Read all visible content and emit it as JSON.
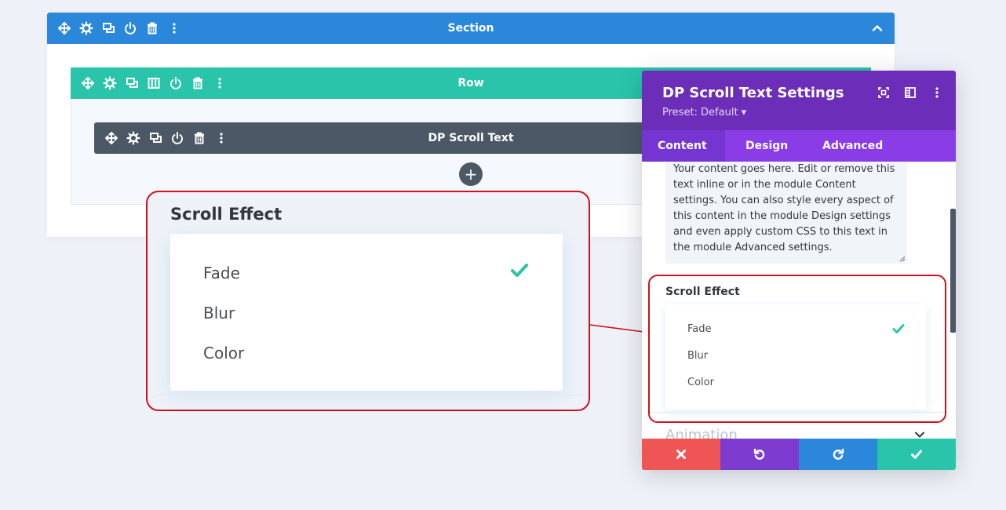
{
  "builder": {
    "section_title": "Section",
    "row_title": "Row",
    "module_title": "DP Scroll Text",
    "add_symbol": "+"
  },
  "zoom_callout": {
    "label": "Scroll Effect",
    "options": [
      "Fade",
      "Blur",
      "Color"
    ],
    "selected": "Fade"
  },
  "panel": {
    "title": "DP Scroll Text Settings",
    "preset": "Preset: Default ▾",
    "tabs": [
      "Content",
      "Design",
      "Advanced"
    ],
    "active_tab": "Content",
    "content_text": "Your content goes here. Edit or remove this text inline or in the module Content settings. You can also style every aspect of this content in the module Design settings and even apply custom CSS to this text in the module Advanced settings.",
    "scroll_effect": {
      "label": "Scroll Effect",
      "options": [
        "Fade",
        "Blur",
        "Color"
      ],
      "selected": "Fade"
    },
    "next_toggle": "Animation",
    "footer_icons": [
      "close-icon",
      "undo-icon",
      "redo-icon",
      "check-icon"
    ]
  },
  "colors": {
    "section": "#2b87da",
    "row": "#29c4a9",
    "module": "#4c5866",
    "panel_header": "#6c2eb9",
    "panel_tabs": "#8a3ce7",
    "check": "#29c4a9",
    "callout_outline": "#d0101d",
    "discard": "#ef5555",
    "undo": "#7e3bd0",
    "redo": "#2b87da",
    "save": "#29c4a9"
  }
}
